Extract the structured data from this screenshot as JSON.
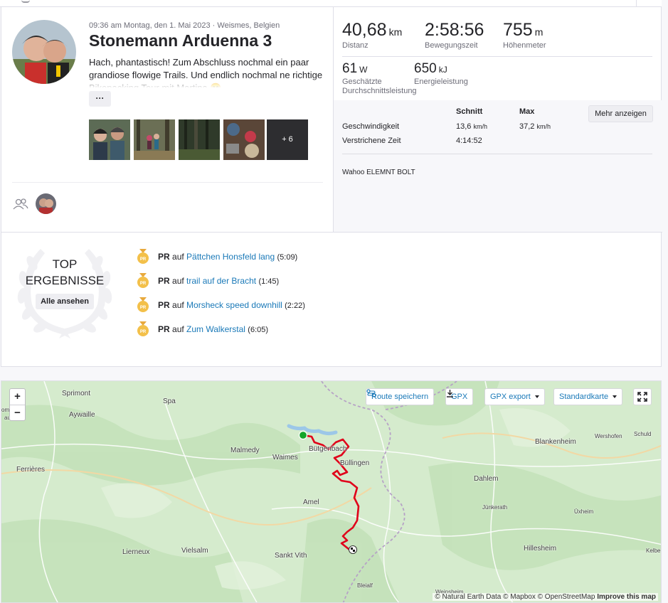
{
  "activity": {
    "meta": "09:36 am Montag, den 1. Mai 2023 · Weismes, Belgien",
    "title": "Stonemann Arduenna 3",
    "description": "Hach, phantastisch! Zum Abschluss nochmal ein paar grandiose flowige Trails. Und endlich nochmal ne richtige Bikepacking Tour mit Martina 😊",
    "more_button": "···",
    "photos_more": "+ 6"
  },
  "stats": {
    "primary": [
      {
        "value": "40,68",
        "unit": "km",
        "label": "Distanz"
      },
      {
        "value": "2:58:56",
        "unit": "",
        "label": "Bewegungszeit"
      },
      {
        "value": "755",
        "unit": "m",
        "label": "Höhenmeter"
      }
    ],
    "secondary": [
      {
        "value": "61",
        "unit": "W",
        "label_line1": "Geschätzte",
        "label_line2": "Durchschnittsleistung"
      },
      {
        "value": "650",
        "unit": "kJ",
        "label_line1": "Energieleistung",
        "label_line2": ""
      }
    ],
    "table": {
      "col_avg": "Schnitt",
      "col_max": "Max",
      "mehr_button": "Mehr anzeigen",
      "rows": [
        {
          "label": "Geschwindigkeit",
          "avg": "13,6",
          "avg_unit": "km/h",
          "max": "37,2",
          "max_unit": "km/h"
        },
        {
          "label": "Verstrichene Zeit",
          "avg": "4:14:52",
          "avg_unit": "",
          "max": "",
          "max_unit": ""
        }
      ]
    },
    "device": "Wahoo ELEMNT BOLT"
  },
  "top_results": {
    "title_line1": "TOP",
    "title_line2": "ERGEBNISSE",
    "all_button": "Alle ansehen",
    "items": [
      {
        "badge": "PR",
        "pr": "PR",
        "auf": "auf",
        "segment": "Pättchen Honsfeld lang",
        "time": "(5:09)"
      },
      {
        "badge": "PR",
        "pr": "PR",
        "auf": "auf",
        "segment": "trail auf der Bracht",
        "time": "(1:45)"
      },
      {
        "badge": "PR",
        "pr": "PR",
        "auf": "auf",
        "segment": "Morsheck speed downhill",
        "time": "(2:22)"
      },
      {
        "badge": "PR",
        "pr": "PR",
        "auf": "auf",
        "segment": "Zum Walkerstal",
        "time": "(6:05)"
      }
    ]
  },
  "map": {
    "zoom_in": "+",
    "zoom_out": "−",
    "route_save": "Route speichern",
    "gpx": "GPX",
    "gpx_export": "GPX export",
    "map_style": "Standardkarte",
    "places": [
      "Sprimont",
      "Aywaille",
      "Spa",
      "Malmedy",
      "Waimes",
      "Bütgenbach",
      "Büllingen",
      "Blankenheim",
      "Wershofen",
      "Schuld",
      "Dahlem",
      "Jünkerath",
      "Üxheim",
      "Amel",
      "Ferrières",
      "Sankt Vith",
      "Lierneux",
      "Vielsalm",
      "Hillesheim",
      "Kelbe",
      "Bleialf",
      "Weinsheim",
      "omblain-",
      "au-Pont"
    ],
    "attribution": "© Natural Earth Data © Mapbox © OpenStreetMap",
    "improve": "Improve this map"
  }
}
